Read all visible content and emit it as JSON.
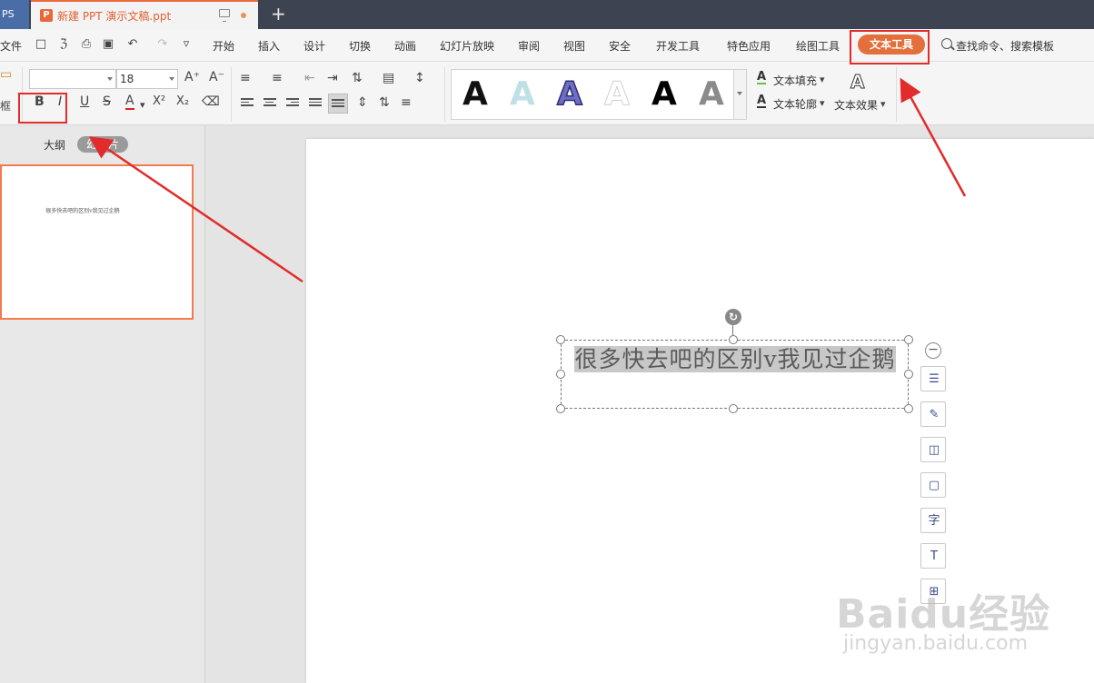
{
  "titlebar": {
    "app_label": "PS",
    "doc_title": "新建 PPT 演示文稿.ppt",
    "doc_icon": "P",
    "new_tab_label": "+"
  },
  "menubar": {
    "file_label": "文件",
    "items": [
      "开始",
      "插入",
      "设计",
      "切换",
      "动画",
      "幻灯片放映",
      "审阅",
      "视图",
      "安全",
      "开发工具",
      "特色应用",
      "绘图工具"
    ],
    "active_tab": "文本工具",
    "search_label": "查找命令、搜索模板"
  },
  "ribbon": {
    "font_name": "",
    "font_size": "18",
    "bold": "B",
    "italic": "I",
    "underline": "U",
    "strike": "S",
    "font_color": "A",
    "superscript": "X²",
    "subscript": "X₂",
    "grow": "A⁺",
    "shrink": "A⁻",
    "left_group_label": "框",
    "style_letter": "A",
    "text_fill_label": "文本填充",
    "text_outline_label": "文本轮廓",
    "text_effect_label": "文本效果"
  },
  "left_panel": {
    "tab_outline": "大纲",
    "tab_slides": "幻灯片",
    "thumb_text": "很多快去吧的区别v我见过企鹅"
  },
  "slide": {
    "text": "很多快去吧的区别v我见过企鹅"
  },
  "watermark": {
    "logo": "Baidu经验",
    "url": "jingyan.baidu.com"
  },
  "colors": {
    "accent": "#e3703c",
    "highlight": "#e22b2b"
  }
}
